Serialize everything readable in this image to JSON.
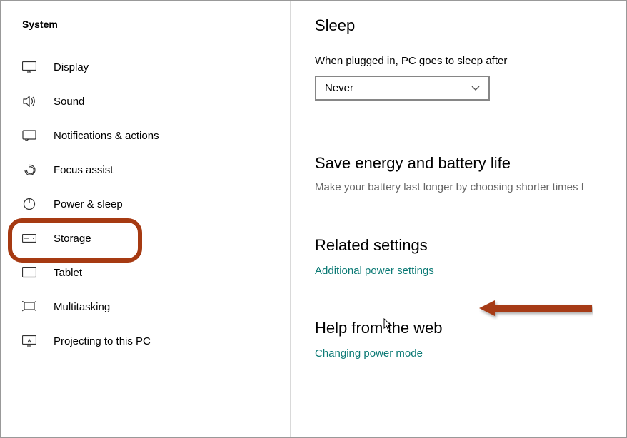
{
  "sidebar": {
    "title": "System",
    "items": [
      {
        "label": "Display"
      },
      {
        "label": "Sound"
      },
      {
        "label": "Notifications & actions"
      },
      {
        "label": "Focus assist"
      },
      {
        "label": "Power & sleep"
      },
      {
        "label": "Storage"
      },
      {
        "label": "Tablet"
      },
      {
        "label": "Multitasking"
      },
      {
        "label": "Projecting to this PC"
      }
    ]
  },
  "main": {
    "sleep_heading": "Sleep",
    "sleep_sub": "When plugged in, PC goes to sleep after",
    "sleep_value": "Never",
    "energy_heading": "Save energy and battery life",
    "energy_desc": "Make your battery last longer by choosing shorter times f",
    "related_heading": "Related settings",
    "related_link": "Additional power settings",
    "help_heading": "Help from the web",
    "help_link": "Changing power mode"
  },
  "annotations": {
    "highlight_color": "#a63a12"
  }
}
